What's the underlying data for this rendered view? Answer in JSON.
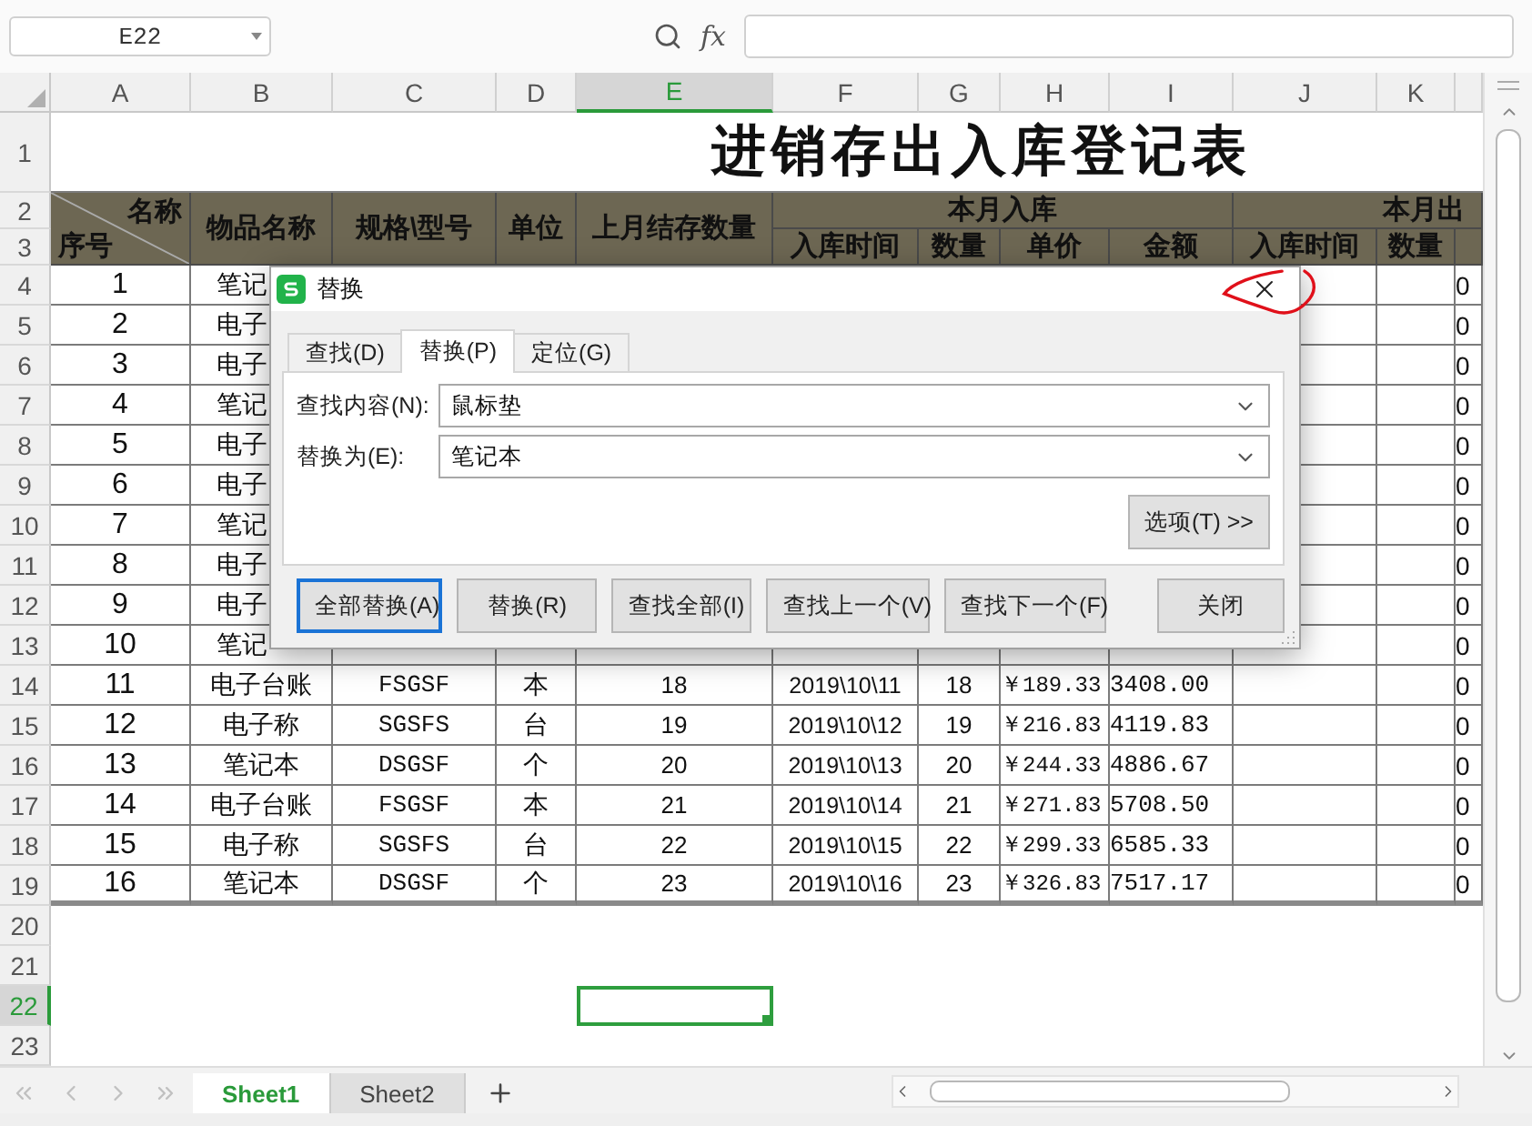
{
  "formula_bar": {
    "name_box": "E22",
    "fx_label": "fx"
  },
  "column_headers": [
    {
      "label": "A",
      "selected": false
    },
    {
      "label": "B",
      "selected": false
    },
    {
      "label": "C",
      "selected": false
    },
    {
      "label": "D",
      "selected": false
    },
    {
      "label": "E",
      "selected": true
    },
    {
      "label": "F",
      "selected": false
    },
    {
      "label": "G",
      "selected": false
    },
    {
      "label": "H",
      "selected": false
    },
    {
      "label": "I",
      "selected": false
    },
    {
      "label": "J",
      "selected": false
    },
    {
      "label": "K",
      "selected": false
    }
  ],
  "row_headers": [
    {
      "label": "1",
      "selected": false
    },
    {
      "label": "2",
      "selected": false
    },
    {
      "label": "3",
      "selected": false
    },
    {
      "label": "4",
      "selected": false
    },
    {
      "label": "5",
      "selected": false
    },
    {
      "label": "6",
      "selected": false
    },
    {
      "label": "7",
      "selected": false
    },
    {
      "label": "8",
      "selected": false
    },
    {
      "label": "9",
      "selected": false
    },
    {
      "label": "10",
      "selected": false
    },
    {
      "label": "11",
      "selected": false
    },
    {
      "label": "12",
      "selected": false
    },
    {
      "label": "13",
      "selected": false
    },
    {
      "label": "14",
      "selected": false
    },
    {
      "label": "15",
      "selected": false
    },
    {
      "label": "16",
      "selected": false
    },
    {
      "label": "17",
      "selected": false
    },
    {
      "label": "18",
      "selected": false
    },
    {
      "label": "19",
      "selected": false
    },
    {
      "label": "20",
      "selected": false
    },
    {
      "label": "21",
      "selected": false
    },
    {
      "label": "22",
      "selected": true
    },
    {
      "label": "23",
      "selected": false
    }
  ],
  "sheet": {
    "title": "进销存出入库登记表",
    "header": {
      "diag_top": "名称",
      "diag_bottom": "序号",
      "name": "物品名称",
      "model": "规格\\型号",
      "unit": "单位",
      "prev_stock": "上月结存数量",
      "in_group": "本月入库",
      "in_time": "入库时间",
      "in_qty": "数量",
      "in_price": "单价",
      "in_amount": "金额",
      "out_group": "本月出",
      "out_time": "入库时间",
      "out_qty": "数量"
    },
    "rows": [
      {
        "kind": "covered",
        "seq": "1",
        "name": "笔记",
        "col_l": "0"
      },
      {
        "kind": "covered",
        "seq": "2",
        "name": "电子",
        "col_l": "0"
      },
      {
        "kind": "covered",
        "seq": "3",
        "name": "电子",
        "col_l": "0"
      },
      {
        "kind": "covered",
        "seq": "4",
        "name": "笔记",
        "col_l": "0"
      },
      {
        "kind": "covered",
        "seq": "5",
        "name": "电子",
        "col_l": "0"
      },
      {
        "kind": "covered",
        "seq": "6",
        "name": "电子",
        "col_l": "0"
      },
      {
        "kind": "covered",
        "seq": "7",
        "name": "笔记",
        "col_l": "0"
      },
      {
        "kind": "covered",
        "seq": "8",
        "name": "电子",
        "col_l": "0"
      },
      {
        "kind": "covered",
        "seq": "9",
        "name": "电子",
        "col_l": "0"
      },
      {
        "kind": "covered",
        "seq": "10",
        "name": "笔记",
        "col_l": "0"
      },
      {
        "kind": "full",
        "seq": "11",
        "name": "电子台账",
        "model": "FSGSF",
        "unit": "本",
        "prev": "18",
        "date": "2019\\10\\11",
        "qty": "18",
        "price": "￥189.33",
        "amount": "3408.00",
        "col_l": "0"
      },
      {
        "kind": "full",
        "seq": "12",
        "name": "电子称",
        "model": "SGSFS",
        "unit": "台",
        "prev": "19",
        "date": "2019\\10\\12",
        "qty": "19",
        "price": "￥216.83",
        "amount": "4119.83",
        "col_l": "0"
      },
      {
        "kind": "full",
        "seq": "13",
        "name": "笔记本",
        "model": "DSGSF",
        "unit": "个",
        "prev": "20",
        "date": "2019\\10\\13",
        "qty": "20",
        "price": "￥244.33",
        "amount": "4886.67",
        "col_l": "0"
      },
      {
        "kind": "full",
        "seq": "14",
        "name": "电子台账",
        "model": "FSGSF",
        "unit": "本",
        "prev": "21",
        "date": "2019\\10\\14",
        "qty": "21",
        "price": "￥271.83",
        "amount": "5708.50",
        "col_l": "0"
      },
      {
        "kind": "full",
        "seq": "15",
        "name": "电子称",
        "model": "SGSFS",
        "unit": "台",
        "prev": "22",
        "date": "2019\\10\\15",
        "qty": "22",
        "price": "￥299.33",
        "amount": "6585.33",
        "col_l": "0"
      },
      {
        "kind": "full",
        "seq": "16",
        "name": "笔记本",
        "model": "DSGSF",
        "unit": "个",
        "prev": "23",
        "date": "2019\\10\\16",
        "qty": "23",
        "price": "￥326.83",
        "amount": "7517.17",
        "col_l": "0"
      }
    ]
  },
  "dialog": {
    "title": "替换",
    "tabs": [
      {
        "label": "查找(D)",
        "selected": false
      },
      {
        "label": "替换(P)",
        "selected": true
      },
      {
        "label": "定位(G)",
        "selected": false
      }
    ],
    "fields": [
      {
        "label": "查找内容(N):",
        "value": "鼠标垫"
      },
      {
        "label": "替换为(E):",
        "value": "笔记本"
      }
    ],
    "options_button": "选项(T) >>",
    "buttons": [
      {
        "label": "全部替换(A)",
        "focused": true
      },
      {
        "label": "替换(R)",
        "focused": false
      },
      {
        "label": "查找全部(I)",
        "focused": false
      },
      {
        "label": "查找上一个(V)",
        "focused": false
      },
      {
        "label": "查找下一个(F)",
        "focused": false
      },
      {
        "label": "关闭",
        "focused": false
      }
    ]
  },
  "sheet_tabs": [
    {
      "label": "Sheet1",
      "selected": true
    },
    {
      "label": "Sheet2",
      "selected": false
    }
  ]
}
